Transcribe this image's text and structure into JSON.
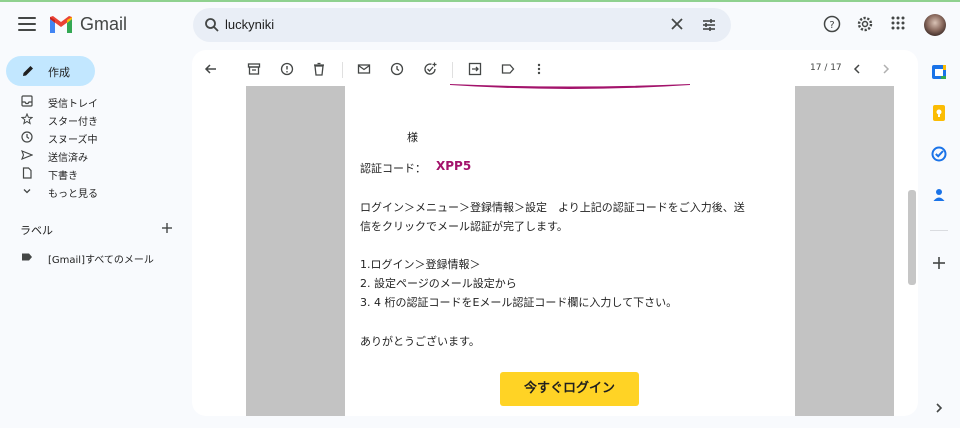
{
  "app": {
    "name": "Gmail",
    "colors": {
      "accent": "#c2e7ff",
      "code": "#a3136b",
      "button": "#ffd325"
    }
  },
  "search": {
    "query": "luckyniki"
  },
  "compose": {
    "label": "作成"
  },
  "sidebar": {
    "items": [
      {
        "label": "受信トレイ",
        "icon": "inbox-icon"
      },
      {
        "label": "スター付き",
        "icon": "star-icon"
      },
      {
        "label": "スヌーズ中",
        "icon": "clock-icon"
      },
      {
        "label": "送信済み",
        "icon": "send-icon"
      },
      {
        "label": "下書き",
        "icon": "draft-icon"
      },
      {
        "label": "もっと見る",
        "icon": "chevron-down-icon"
      }
    ],
    "labels_heading": "ラベル",
    "labels": [
      {
        "label": "[Gmail]すべてのメール",
        "icon": "label-icon"
      }
    ]
  },
  "toolbar": {
    "pager": "17 / 17"
  },
  "email": {
    "salutation": "様",
    "code_label": "認証コード：",
    "code_value": "XPP5",
    "para1_line1": "ログイン＞メニュー＞登録情報＞設定　より上記の認証コードをご入力後、送",
    "para1_line2": "信をクリックでメール認証が完了します。",
    "step1": "1.ログイン＞登録情報＞",
    "step2": "2. 設定ページのメール設定から",
    "step3": "3. 4 桁の認証コードをEメール認証コード欄に入力して下さい。",
    "thanks": "ありがとうございます。",
    "login_button": "今すぐログイン"
  }
}
